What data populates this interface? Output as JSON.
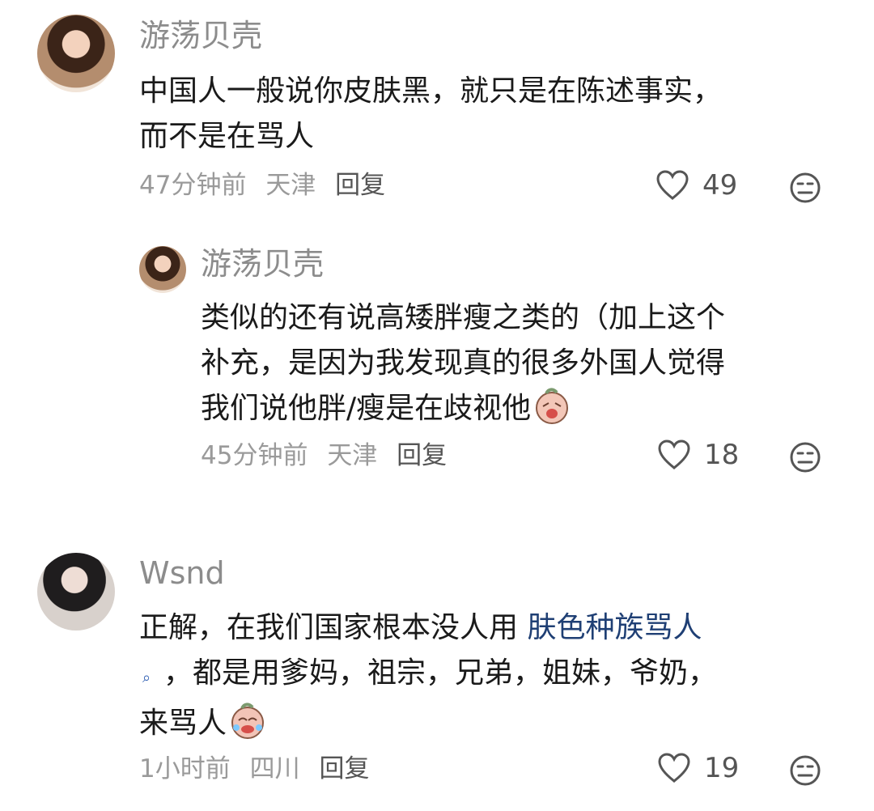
{
  "comments": [
    {
      "username": "游荡贝壳",
      "text_lines": [
        "中国人一般说你皮肤黑，就只是在陈述事实，",
        "而不是在骂人"
      ],
      "time": "47分钟前",
      "location": "天津",
      "reply_label": "回复",
      "likes": "49"
    },
    {
      "username": "游荡贝壳",
      "text_lines": [
        "类似的还有说高矮胖瘦之类的（加上这个",
        "补充，是因为我发现真的很多外国人觉得",
        "我们说他胖/瘦是在歧视他"
      ],
      "time": "45分钟前",
      "location": "天津",
      "reply_label": "回复",
      "likes": "18"
    },
    {
      "username": "Wsnd",
      "text_line1_prefix": "正解，在我们国家根本没人用 ",
      "text_line1_link": "肤色种族骂人",
      "text_line2": "，都是用爹妈，祖宗，兄弟，姐妹，爷奶，",
      "text_line3": "来骂人",
      "time": "1小时前",
      "location": "四川",
      "reply_label": "回复",
      "likes": "19"
    }
  ],
  "icons": {
    "heart": "heart-icon",
    "dislike": "expressionless-face-icon",
    "search": "search-icon",
    "emoji": "emoji-icon"
  },
  "colors": {
    "link": "#1f3f74",
    "muted": "#9a9a9a",
    "text": "#1a1a1a"
  }
}
